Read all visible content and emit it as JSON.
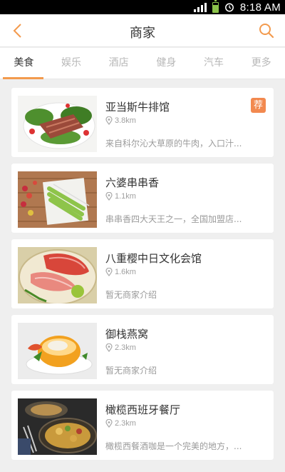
{
  "status_bar": {
    "time": "8:18 AM"
  },
  "header": {
    "title": "商家"
  },
  "tabs": [
    {
      "label": "美食",
      "active": true
    },
    {
      "label": "娱乐"
    },
    {
      "label": "酒店"
    },
    {
      "label": "健身"
    },
    {
      "label": "汽车"
    },
    {
      "label": "更多"
    }
  ],
  "merchants": [
    {
      "name": "亚当斯牛排馆",
      "distance": "3.8km",
      "description": "来自科尔沁大草原的牛肉，入口汁...",
      "badge": "荐"
    },
    {
      "name": "六婆串串香",
      "distance": "1.1km",
      "description": "串串香四大天王之一，全国加盟店..."
    },
    {
      "name": "八重樱中日文化会馆",
      "distance": "1.6km",
      "description": "暂无商家介绍"
    },
    {
      "name": "御栈燕窝",
      "distance": "2.3km",
      "description": "暂无商家介绍"
    },
    {
      "name": "橄榄西班牙餐厅",
      "distance": "2.3km",
      "description": "橄榄西餐酒咖是一个完美的地方，..."
    }
  ],
  "colors": {
    "accent": "#f39a4d",
    "badge": "#f2894f"
  }
}
